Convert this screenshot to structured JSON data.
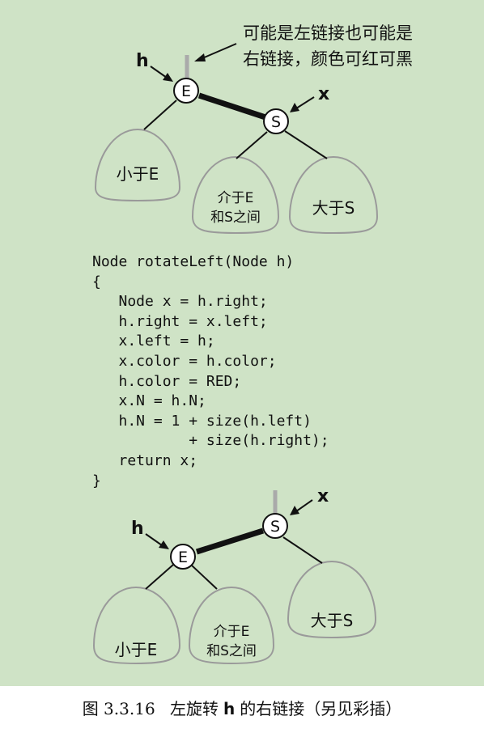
{
  "top_diagram": {
    "note_line1": "可能是左链接也可能是",
    "note_line2": "右链接，颜色可红可黑",
    "label_h": "h",
    "label_x": "x",
    "node_E": "E",
    "node_S": "S",
    "subtree_left": "小于E",
    "subtree_middle_line1": "介于E",
    "subtree_middle_line2": "和S之间",
    "subtree_right": "大于S"
  },
  "code": {
    "lines": [
      "Node rotateLeft(Node h)",
      "{",
      "   Node x = h.right;",
      "   h.right = x.left;",
      "   x.left = h;",
      "   x.color = h.color;",
      "   h.color = RED;",
      "   x.N = h.N;",
      "   h.N = 1 + size(h.left)",
      "           + size(h.right);",
      "   return x;",
      "}"
    ]
  },
  "bottom_diagram": {
    "label_h": "h",
    "label_x": "x",
    "node_E": "E",
    "node_S": "S",
    "subtree_left": "小于E",
    "subtree_middle_line1": "介于E",
    "subtree_middle_line2": "和S之间",
    "subtree_right": "大于S"
  },
  "caption": {
    "figure_number": "图 3.3.16",
    "text_before": "左旋转",
    "text_h": "h",
    "text_after": "的右链接（另见彩插）"
  },
  "colors": {
    "panel_background": "#cfe3c6",
    "node_fill": "#ffffff",
    "link_color": "#111111",
    "subtree_outline": "#9a9a9a",
    "subtree_fill": "#cfe3c6"
  }
}
